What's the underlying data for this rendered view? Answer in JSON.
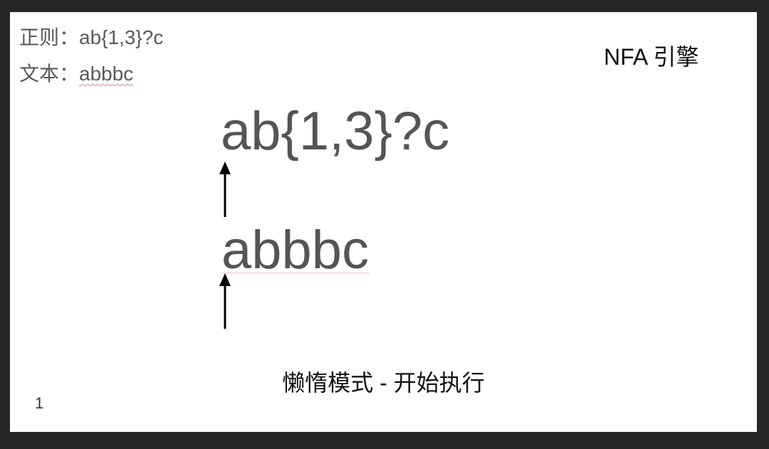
{
  "meta": {
    "regex_label": "正则：",
    "regex_value": "ab{1,3}?c",
    "text_label": "文本：",
    "text_value": "abbbc"
  },
  "engine_title": "NFA 引擎",
  "main": {
    "regex_display": "ab{1,3}?c",
    "text_display": "abbbc"
  },
  "caption": "懒惰模式 - 开始执行",
  "page_number": "1",
  "colors": {
    "background": "#262626",
    "slide": "#ffffff",
    "text_gray": "#555555",
    "spellcheck_underline": "#d98c8c"
  }
}
